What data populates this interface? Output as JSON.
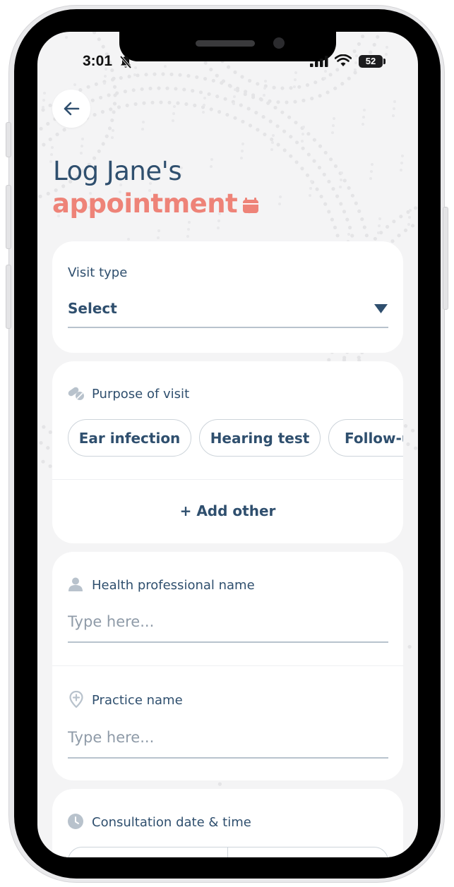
{
  "status_bar": {
    "time": "3:01",
    "battery": "52"
  },
  "header": {
    "title_line1": "Log Jane's",
    "title_line2": "appointment"
  },
  "visit_type": {
    "label": "Visit type",
    "value": "Select"
  },
  "purpose": {
    "label": "Purpose of visit",
    "chips": [
      "Ear infection",
      "Hearing test",
      "Follow-u"
    ],
    "add_other": "+ Add other"
  },
  "health_professional": {
    "label": "Health professional name",
    "placeholder": "Type here..."
  },
  "practice": {
    "label": "Practice name",
    "placeholder": "Type here..."
  },
  "consultation": {
    "label": "Consultation date & time"
  },
  "colors": {
    "primary_text": "#2f4f6e",
    "accent": "#ee8378",
    "muted_icon": "#b8c2cc",
    "background": "#f4f4f5"
  },
  "icons": {
    "back": "arrow-left-icon",
    "title_accent": "calendar-icon",
    "dropdown": "triangle-down-icon",
    "purpose": "pill-icon",
    "professional": "person-icon",
    "practice": "location-plus-icon",
    "consultation": "clock-icon"
  }
}
